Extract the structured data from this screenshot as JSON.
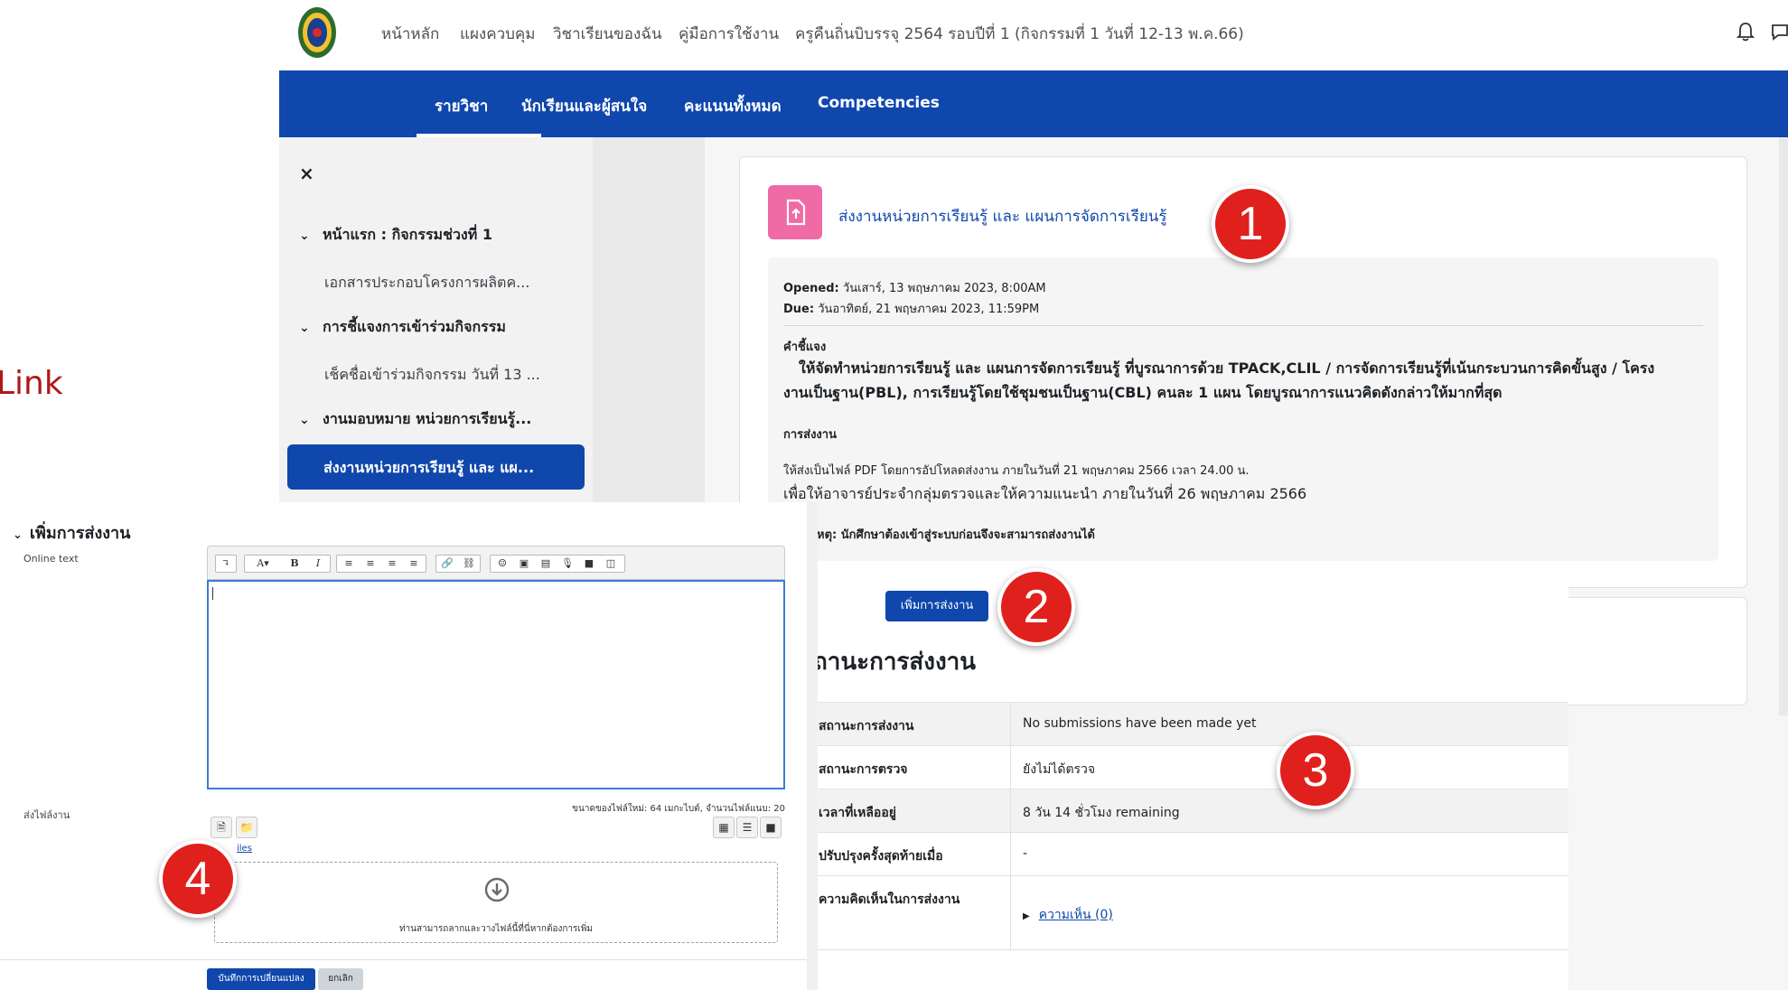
{
  "topnav": {
    "links": [
      "หน้าหลัก",
      "แผงควบคุม",
      "วิชาเรียนของฉัน",
      "คู่มือการใช้งาน",
      "ครูคืนถิ่นบิบรรจุ 2564 รอบปีที่ 1 (กิจกรรมที่ 1 วันที่ 12-13 พ.ค.66)"
    ],
    "icons": [
      "bell-icon",
      "chat-icon"
    ]
  },
  "course_tabs": [
    "รายวิชา",
    "นักเรียนและผู้สนใจ",
    "คะแนนทั้งหมด",
    "Competencies"
  ],
  "drawer": {
    "close": "×",
    "sections": [
      {
        "label": "หน้าแรก : กิจกรรมช่วงที่ 1",
        "activity": "เอกสารประกอบโครงการผลิตค..."
      },
      {
        "label": "การชี้แจงการเข้าร่วมกิจกรรม",
        "activity": "เช็คชื่อเข้าร่วมกิจกรรม วันที่ 13 ..."
      },
      {
        "label": "งานมอบหมาย หน่วยการเรียนรู้...",
        "activity": "ส่งงานหน่วยการเรียนรู้ และ แผ..."
      }
    ]
  },
  "assignment": {
    "title": "ส่งงานหน่วยการเรียนรู้ และ แผนการจัดการเรียนรู้",
    "opened_label": "Opened:",
    "opened": "วันเสาร์, 13 พฤษภาคม 2023, 8:00AM",
    "due_label": "Due:",
    "due": "วันอาทิตย์, 21 พฤษภาคม 2023, 11:59PM",
    "instructions_heading": "คำชี้แจง",
    "instructions_line1": "ให้จัดทำหน่วยการเรียนรู้ และ แผนการจัดการเรียนรู้ ที่บูรณาการด้วย TPACK,CLIL / การจัดการเรียนรู้ที่เน้นกระบวนการคิดขั้นสูง / โครง",
    "instructions_line2": "งานเป็นฐาน(PBL), การเรียนรู้โดยใช้ชุมชนเป็นฐาน(CBL) คนละ 1 แผน โดยบูรณาการแนวคิดดังกล่าวให้มากที่สุด",
    "submission_heading": "การส่งงาน",
    "submission_line1": "ให้ส่งเป็นไฟล์ PDF โดยการอัปโหลดส่งงาน ภายในวันที่ 21 พฤษภาคม 2566 เวลา 24.00 น.",
    "submission_line2": "เพื่อให้อาจารย์ประจำกลุ่มตรวจและให้ความแนะนำ   ภายในวันที่ 26 พฤษภาคม 2566",
    "note": "หตุ: นักศึกษาต้องเข้าสู่ระบบก่อนจึงจะสามารถส่งงานได้"
  },
  "status": {
    "add_submission": "เพิ่มการส่งงาน",
    "heading": "ถานะการส่งงาน",
    "rows": [
      {
        "label": "สถานะการส่งงาน",
        "value": "No submissions have been made yet"
      },
      {
        "label": "สถานะการตรวจ",
        "value": "ยังไม่ได้ตรวจ"
      },
      {
        "label": "เวลาที่เหลืออยู่",
        "value": "8 วัน 14 ชั่วโมง remaining"
      },
      {
        "label": "ปรับปรุงครั้งสุดท้ายเมื่อ",
        "value": "-"
      },
      {
        "label": "ความคิดเห็นในการส่งงาน",
        "value": "ความเห็น (0)"
      }
    ]
  },
  "form": {
    "heading": "เพิ่มการส่งงาน",
    "online_text_label": "Online text",
    "files_label": "ส่งไฟล์งาน",
    "maxsize": "ขนาดของไฟล์ใหม่: 64 เมกะไบต์, จำนวนไฟล์แนบ: 20",
    "files_link": "iles",
    "drop_text": "ท่านสามารถลากและวางไฟล์นี้ที่นี่หากต้องการเพิ่ม",
    "save": "บันทึกการเปลี่ยนแปลง",
    "cancel": "ยกเลิก",
    "toolbar": [
      "↴",
      "A▾",
      "B",
      "I",
      "≡",
      "≡",
      "≡",
      "≡",
      "🔗",
      "⛓",
      "☺",
      "▣",
      "▤",
      "🎙",
      "■",
      "◫"
    ]
  },
  "link_fragment": "Link",
  "callouts": [
    "1",
    "2",
    "3",
    "4"
  ],
  "colors": {
    "brand": "#0f47ad",
    "badge": "#e0201d",
    "assign_icon": "#f06aa6"
  }
}
